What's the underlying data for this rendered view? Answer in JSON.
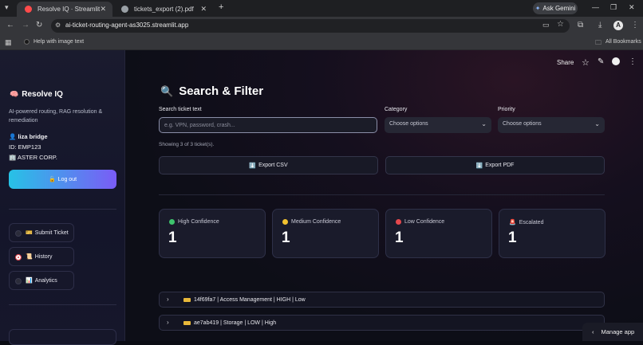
{
  "browser": {
    "tabs": [
      {
        "title": "Resolve IQ · Streamlit",
        "active": true,
        "favicon_color": "#ff4b4b"
      },
      {
        "title": "tickets_export (2).pdf",
        "active": false,
        "favicon_color": "#9aa0a6"
      }
    ],
    "new_tab_label": "+",
    "ask_gemini_label": "Ask Gemini",
    "url": "ai-ticket-routing-agent-as3025.streamlit.app",
    "avatar_letter": "A",
    "bookmarks_bar": {
      "help_label": "Help with image text",
      "all_bookmarks_label": "All Bookmarks"
    }
  },
  "app_toolbar": {
    "share_label": "Share"
  },
  "sidebar": {
    "brand_icon": "🧠",
    "brand": "Resolve IQ",
    "tagline": "AI-powered routing, RAG resolution & remediation",
    "user_icon": "👤",
    "user_name": "liza bridge",
    "user_id": "ID: EMP123",
    "org_icon": "🏢",
    "org": "ASTER CORP.",
    "logout_icon": "🔓",
    "logout_label": "Log out",
    "nav": [
      {
        "icon": "🎫",
        "label": "Submit Ticket",
        "selected": false
      },
      {
        "icon": "📜",
        "label": "History",
        "selected": true
      },
      {
        "icon": "📊",
        "label": "Analytics",
        "selected": false
      }
    ]
  },
  "main": {
    "title_icon": "🔍",
    "title": "Search & Filter",
    "search": {
      "label": "Search ticket text",
      "placeholder": "e.g. VPN, password, crash..."
    },
    "category": {
      "label": "Category",
      "placeholder": "Choose options"
    },
    "priority": {
      "label": "Priority",
      "placeholder": "Choose options"
    },
    "showing": "Showing 3 of 3 ticket(s).",
    "export_csv": {
      "icon": "⬇️",
      "label": "Export CSV"
    },
    "export_pdf": {
      "icon": "⬇️",
      "label": "Export PDF"
    },
    "metrics": [
      {
        "label": "High Confidence",
        "value": "1",
        "dot_color": "#3ec46d"
      },
      {
        "label": "Medium Confidence",
        "value": "1",
        "dot_color": "#f2c230"
      },
      {
        "label": "Low Confidence",
        "value": "1",
        "dot_color": "#e5484d"
      },
      {
        "label": "Escalated",
        "value": "1",
        "icon": "🚨"
      }
    ],
    "tickets": [
      {
        "summary": "14f69fa7 | Access Management | HIGH | Low"
      },
      {
        "summary": "ae7ab419 | Storage | LOW | High"
      }
    ]
  },
  "manage_app_label": "Manage app"
}
